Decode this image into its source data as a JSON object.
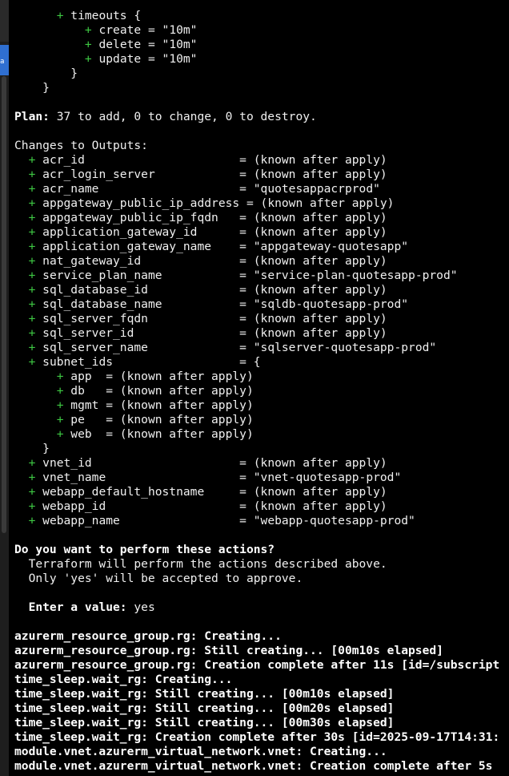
{
  "left_strip": {
    "badge": "a",
    "accent": "#2f6fd1"
  },
  "colors": {
    "background": "#000000",
    "text": "#f0f0f0",
    "plus": "#3ec843"
  },
  "lines": [
    [
      {
        "t": "      "
      },
      {
        "t": "+",
        "c": "g"
      },
      {
        "t": " timeouts {"
      }
    ],
    [
      {
        "t": "          "
      },
      {
        "t": "+",
        "c": "g"
      },
      {
        "t": " create = \"10m\""
      }
    ],
    [
      {
        "t": "          "
      },
      {
        "t": "+",
        "c": "g"
      },
      {
        "t": " delete = \"10m\""
      }
    ],
    [
      {
        "t": "          "
      },
      {
        "t": "+",
        "c": "g"
      },
      {
        "t": " update = \"10m\""
      }
    ],
    [
      {
        "t": "        }"
      }
    ],
    [
      {
        "t": "    }"
      }
    ],
    [
      {
        "t": ""
      }
    ],
    [
      {
        "t": "Plan:",
        "c": "b"
      },
      {
        "t": " 37 to add, 0 to change, 0 to destroy."
      }
    ],
    [
      {
        "t": ""
      }
    ],
    [
      {
        "t": "Changes to Outputs:"
      }
    ],
    [
      {
        "t": "  "
      },
      {
        "t": "+",
        "c": "g"
      },
      {
        "t": " acr_id                      = (known after apply)"
      }
    ],
    [
      {
        "t": "  "
      },
      {
        "t": "+",
        "c": "g"
      },
      {
        "t": " acr_login_server            = (known after apply)"
      }
    ],
    [
      {
        "t": "  "
      },
      {
        "t": "+",
        "c": "g"
      },
      {
        "t": " acr_name                    = \"quotesappacrprod\""
      }
    ],
    [
      {
        "t": "  "
      },
      {
        "t": "+",
        "c": "g"
      },
      {
        "t": " appgateway_public_ip_address = (known after apply)"
      }
    ],
    [
      {
        "t": "  "
      },
      {
        "t": "+",
        "c": "g"
      },
      {
        "t": " appgateway_public_ip_fqdn   = (known after apply)"
      }
    ],
    [
      {
        "t": "  "
      },
      {
        "t": "+",
        "c": "g"
      },
      {
        "t": " application_gateway_id      = (known after apply)"
      }
    ],
    [
      {
        "t": "  "
      },
      {
        "t": "+",
        "c": "g"
      },
      {
        "t": " application_gateway_name    = \"appgateway-quotesapp\""
      }
    ],
    [
      {
        "t": "  "
      },
      {
        "t": "+",
        "c": "g"
      },
      {
        "t": " nat_gateway_id              = (known after apply)"
      }
    ],
    [
      {
        "t": "  "
      },
      {
        "t": "+",
        "c": "g"
      },
      {
        "t": " service_plan_name           = \"service-plan-quotesapp-prod\""
      }
    ],
    [
      {
        "t": "  "
      },
      {
        "t": "+",
        "c": "g"
      },
      {
        "t": " sql_database_id             = (known after apply)"
      }
    ],
    [
      {
        "t": "  "
      },
      {
        "t": "+",
        "c": "g"
      },
      {
        "t": " sql_database_name           = \"sqldb-quotesapp-prod\""
      }
    ],
    [
      {
        "t": "  "
      },
      {
        "t": "+",
        "c": "g"
      },
      {
        "t": " sql_server_fqdn             = (known after apply)"
      }
    ],
    [
      {
        "t": "  "
      },
      {
        "t": "+",
        "c": "g"
      },
      {
        "t": " sql_server_id               = (known after apply)"
      }
    ],
    [
      {
        "t": "  "
      },
      {
        "t": "+",
        "c": "g"
      },
      {
        "t": " sql_server_name             = \"sqlserver-quotesapp-prod\""
      }
    ],
    [
      {
        "t": "  "
      },
      {
        "t": "+",
        "c": "g"
      },
      {
        "t": " subnet_ids                  = {"
      }
    ],
    [
      {
        "t": "      "
      },
      {
        "t": "+",
        "c": "g"
      },
      {
        "t": " app  = (known after apply)"
      }
    ],
    [
      {
        "t": "      "
      },
      {
        "t": "+",
        "c": "g"
      },
      {
        "t": " db   = (known after apply)"
      }
    ],
    [
      {
        "t": "      "
      },
      {
        "t": "+",
        "c": "g"
      },
      {
        "t": " mgmt = (known after apply)"
      }
    ],
    [
      {
        "t": "      "
      },
      {
        "t": "+",
        "c": "g"
      },
      {
        "t": " pe   = (known after apply)"
      }
    ],
    [
      {
        "t": "      "
      },
      {
        "t": "+",
        "c": "g"
      },
      {
        "t": " web  = (known after apply)"
      }
    ],
    [
      {
        "t": "    }"
      }
    ],
    [
      {
        "t": "  "
      },
      {
        "t": "+",
        "c": "g"
      },
      {
        "t": " vnet_id                     = (known after apply)"
      }
    ],
    [
      {
        "t": "  "
      },
      {
        "t": "+",
        "c": "g"
      },
      {
        "t": " vnet_name                   = \"vnet-quotesapp-prod\""
      }
    ],
    [
      {
        "t": "  "
      },
      {
        "t": "+",
        "c": "g"
      },
      {
        "t": " webapp_default_hostname     = (known after apply)"
      }
    ],
    [
      {
        "t": "  "
      },
      {
        "t": "+",
        "c": "g"
      },
      {
        "t": " webapp_id                   = (known after apply)"
      }
    ],
    [
      {
        "t": "  "
      },
      {
        "t": "+",
        "c": "g"
      },
      {
        "t": " webapp_name                 = \"webapp-quotesapp-prod\""
      }
    ],
    [
      {
        "t": ""
      }
    ],
    [
      {
        "t": "Do you want to perform these actions?",
        "c": "b"
      }
    ],
    [
      {
        "t": "  Terraform will perform the actions described above."
      }
    ],
    [
      {
        "t": "  Only 'yes' will be accepted to approve."
      }
    ],
    [
      {
        "t": ""
      }
    ],
    [
      {
        "t": "  "
      },
      {
        "t": "Enter a value:",
        "c": "b"
      },
      {
        "t": " yes"
      }
    ],
    [
      {
        "t": ""
      }
    ],
    [
      {
        "t": "azurerm_resource_group.rg: Creating...",
        "c": "b"
      }
    ],
    [
      {
        "t": "azurerm_resource_group.rg: Still creating... [00m10s elapsed]",
        "c": "b"
      }
    ],
    [
      {
        "t": "azurerm_resource_group.rg: Creation complete after 11s [id=/subscript",
        "c": "b"
      }
    ],
    [
      {
        "t": "time_sleep.wait_rg: Creating...",
        "c": "b"
      }
    ],
    [
      {
        "t": "time_sleep.wait_rg: Still creating... [00m10s elapsed]",
        "c": "b"
      }
    ],
    [
      {
        "t": "time_sleep.wait_rg: Still creating... [00m20s elapsed]",
        "c": "b"
      }
    ],
    [
      {
        "t": "time_sleep.wait_rg: Still creating... [00m30s elapsed]",
        "c": "b"
      }
    ],
    [
      {
        "t": "time_sleep.wait_rg: Creation complete after 30s [id=2025-09-17T14:31:",
        "c": "b"
      }
    ],
    [
      {
        "t": "module.vnet.azurerm_virtual_network.vnet: Creating...",
        "c": "b"
      }
    ],
    [
      {
        "t": "module.vnet.azurerm_virtual_network.vnet: Creation complete after 5s",
        "c": "b"
      }
    ]
  ]
}
